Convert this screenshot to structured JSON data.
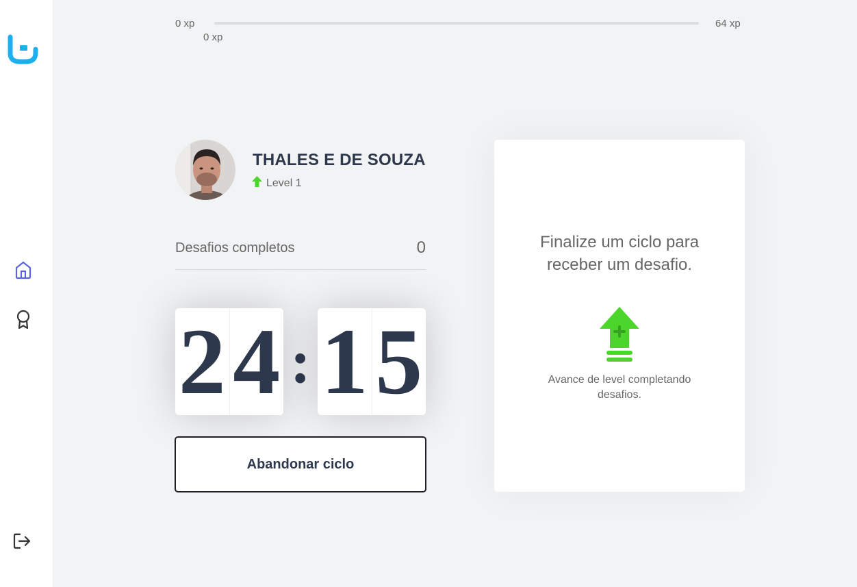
{
  "experience": {
    "start_label": "0 xp",
    "end_label": "64 xp",
    "current_label": "0 xp",
    "progress_fraction": 0
  },
  "profile": {
    "name": "THALES E DE SOUZA",
    "level_label": "Level 1"
  },
  "completed_challenges": {
    "label": "Desafios completos",
    "value": "0"
  },
  "countdown": {
    "minute_left": "2",
    "minute_right": "4",
    "separator": ":",
    "second_left": "1",
    "second_right": "5"
  },
  "actions": {
    "abandon_label": "Abandonar ciclo"
  },
  "challenge_box": {
    "title": "Finalize um ciclo para receber um desafio.",
    "description": "Avance de level completando desafios."
  },
  "icons": {
    "logo": "brand-logo-icon",
    "home": "home-icon",
    "award": "award-icon",
    "logout": "logout-icon",
    "level_up": "level-up-arrow-icon"
  },
  "colors": {
    "background": "#f2f3f5",
    "sidebar": "#ffffff",
    "text": "#666666",
    "title": "#2e384d",
    "blue": "#5965e0",
    "brand_cyan": "#1cb0ec",
    "green": "#4cd62b"
  }
}
